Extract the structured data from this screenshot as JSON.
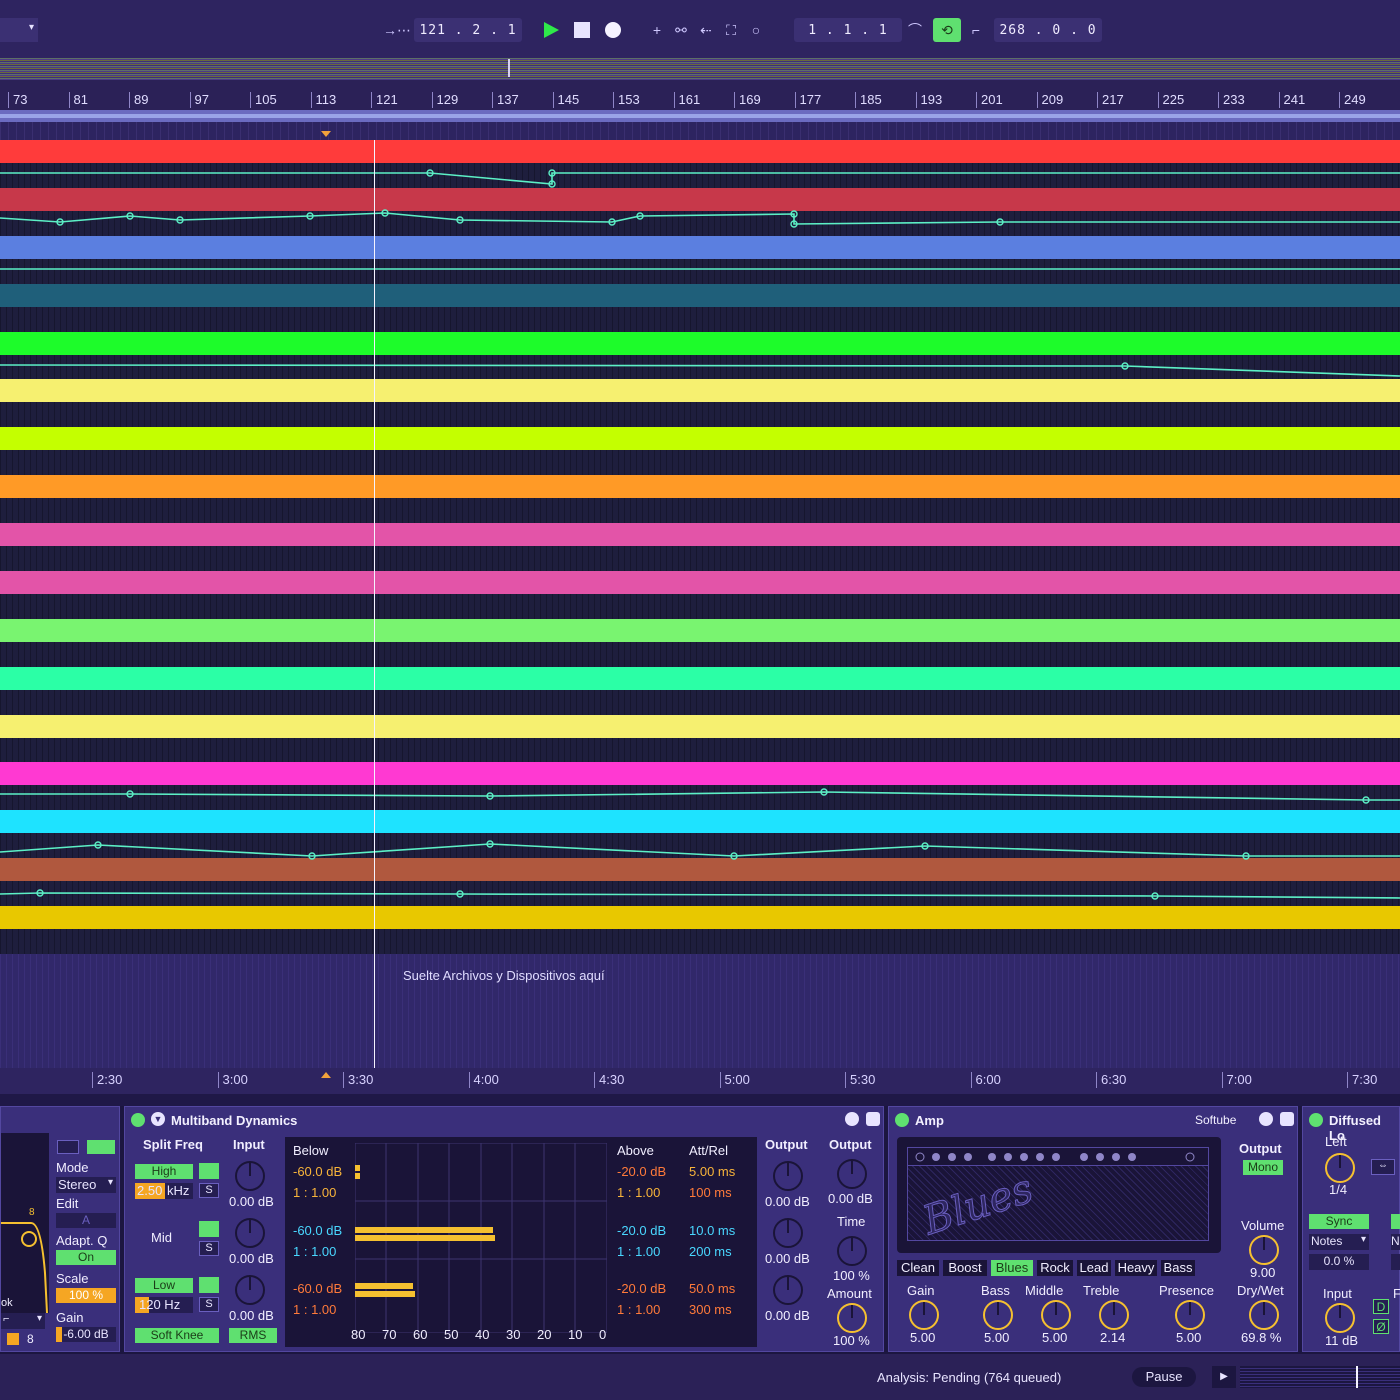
{
  "transport": {
    "tempo_dropdown_label": "",
    "arrangement_position": "121 .  2 .  1",
    "loop_start": "1 .  1 .  1",
    "loop_length": "268 .  0 .  0",
    "colors": {
      "play": "#2fe84a",
      "loop_active": "#5fe070"
    }
  },
  "ruler": {
    "bars": [
      "73",
      "81",
      "89",
      "97",
      "105",
      "113",
      "121",
      "129",
      "137",
      "145",
      "153",
      "161",
      "169",
      "177",
      "185",
      "193",
      "201",
      "209",
      "217",
      "225",
      "233",
      "241",
      "249"
    ]
  },
  "arrangement": {
    "drop_hint": "Suelte Archivos y Dispositivos aquí",
    "track_colors": [
      "#ff3b3b",
      "#c7384a",
      "#5b7fe0",
      "#1f5f7a",
      "#1dfc2a",
      "#f6f070",
      "#c4ff00",
      "#ff9a26",
      "#e354a8",
      "#e354a8",
      "#79f470",
      "#2bffa6",
      "#f6f070",
      "#ff39d2",
      "#1ee3ff",
      "#b0583e",
      "#e8c800"
    ]
  },
  "timeline": {
    "marks": [
      "2:30",
      "3:00",
      "3:30",
      "4:00",
      "4:30",
      "5:00",
      "5:30",
      "6:00",
      "6:30",
      "7:00",
      "7:30"
    ]
  },
  "eq_partial": {
    "mode_label": "Mode",
    "mode_value": "Stereo",
    "edit_label": "Edit",
    "edit_value": "A",
    "adapt_q_label": "Adapt. Q",
    "adapt_q_value": "On",
    "scale_label": "Scale",
    "scale_value": "100 %",
    "gain_label": "Gain",
    "gain_value": "-6.00 dB",
    "band_number": "8",
    "partial_text": "ok"
  },
  "multiband": {
    "title": "Multiband Dynamics",
    "split_freq": "Split Freq",
    "input": "Input",
    "high_label": "High",
    "high_freq": "2.50",
    "high_unit": "kHz",
    "mid_label": "Mid",
    "low_label": "Low",
    "low_freq": "120 Hz",
    "solo": "S",
    "input_gain": "0.00 dB",
    "below": "Below",
    "above": "Above",
    "att_rel": "Att/Rel",
    "bands": [
      {
        "below_thresh": "-60.0 dB",
        "below_ratio": "1 : 1.00",
        "above_thresh": "-20.0 dB",
        "above_ratio": "1 : 1.00",
        "attack": "5.00 ms",
        "release": "100 ms",
        "output": "0.00 dB"
      },
      {
        "below_thresh": "-60.0 dB",
        "below_ratio": "1 : 1.00",
        "above_thresh": "-20.0 dB",
        "above_ratio": "1 : 1.00",
        "attack": "10.0 ms",
        "release": "200 ms",
        "output": "0.00 dB"
      },
      {
        "below_thresh": "-60.0 dB",
        "below_ratio": "1 : 1.00",
        "above_thresh": "-20.0 dB",
        "above_ratio": "1 : 1.00",
        "attack": "50.0 ms",
        "release": "300 ms",
        "output": "0.00 dB"
      }
    ],
    "scale_ticks": [
      "80",
      "70",
      "60",
      "50",
      "40",
      "30",
      "20",
      "10",
      "0"
    ],
    "output_label": "Output",
    "output2_label": "Output",
    "output2_value": "0.00 dB",
    "time_label": "Time",
    "time_value": "100 %",
    "amount_label": "Amount",
    "amount_value": "100 %",
    "soft_knee": "Soft Knee",
    "rms": "RMS"
  },
  "amp": {
    "title": "Amp",
    "brand": "Softube",
    "amp_logo": "Blues",
    "types": [
      "Clean",
      "Boost",
      "Blues",
      "Rock",
      "Lead",
      "Heavy",
      "Bass"
    ],
    "active_type": "Blues",
    "output_label": "Output",
    "output_value": "Mono",
    "volume_label": "Volume",
    "volume_value": "9.00",
    "drywet_label": "Dry/Wet",
    "drywet_value": "69.8 %",
    "knobs": [
      {
        "label": "Gain",
        "value": "5.00"
      },
      {
        "label": "Bass",
        "value": "5.00"
      },
      {
        "label": "Middle",
        "value": "5.00"
      },
      {
        "label": "Treble",
        "value": "2.14"
      },
      {
        "label": "Presence",
        "value": "5.00"
      }
    ]
  },
  "diffused": {
    "title": "Diffused Lo",
    "left_label": "Left",
    "left_value": "1/4",
    "sync": "Sync",
    "notes": "Notes",
    "percent": "0.0 %",
    "input_label": "Input",
    "input_value": "11 dB",
    "d_label": "D",
    "phase_label": "Ø",
    "edge_f": "F",
    "edge_n": "N"
  },
  "status": {
    "analysis_text": "Analysis: Pending (764 queued)",
    "pause_label": "Pause"
  }
}
